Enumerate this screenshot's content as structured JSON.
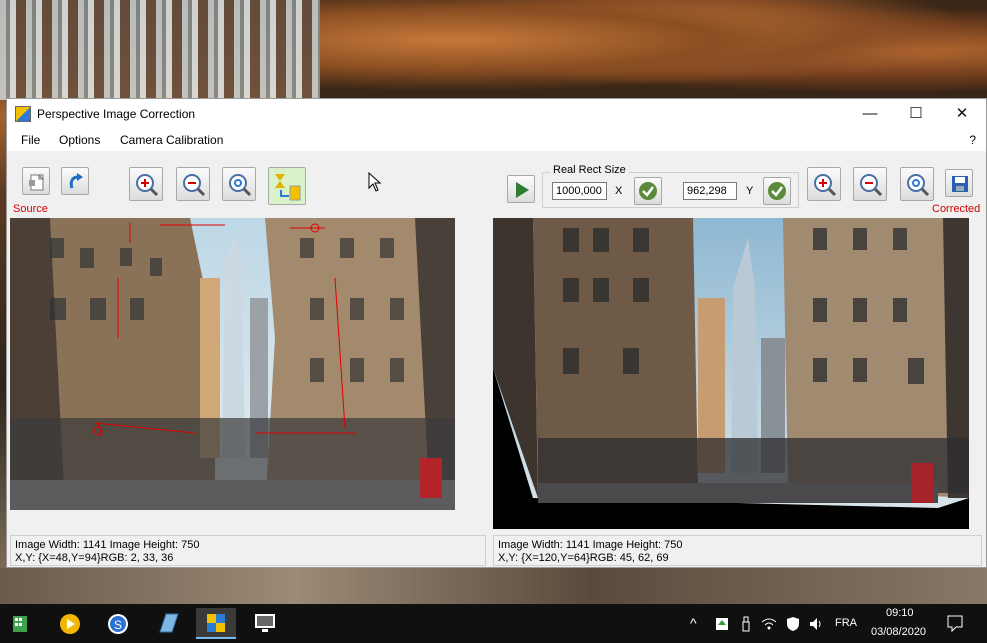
{
  "window": {
    "title": "Perspective Image Correction",
    "minimize": "—",
    "maximize": "☐",
    "close": "✕"
  },
  "menu": {
    "items": [
      "File",
      "Options",
      "Camera Calibration"
    ],
    "help": "?"
  },
  "toolbar": {
    "source_label": "Source",
    "corrected_label": "Corrected",
    "real_rect_title": "Real Rect Size",
    "x_value": "1000,000",
    "x_label": "X",
    "y_value": "962,298",
    "y_label": "Y"
  },
  "left_status": {
    "line1": "Image Width: 1141 Image Height: 750",
    "line2": "X,Y: {X=48,Y=94}RGB: 2, 33, 36"
  },
  "right_status": {
    "line1": "Image Width: 1141 Image Height: 750",
    "line2": "X,Y: {X=120,Y=64}RGB: 45, 62, 69"
  },
  "taskbar": {
    "language": "FRA",
    "time": "09:10",
    "date": "03/08/2020"
  },
  "colors": {
    "accent_red": "#d40000",
    "taskbar": "#101010",
    "window_bg": "#f0f0f0"
  }
}
